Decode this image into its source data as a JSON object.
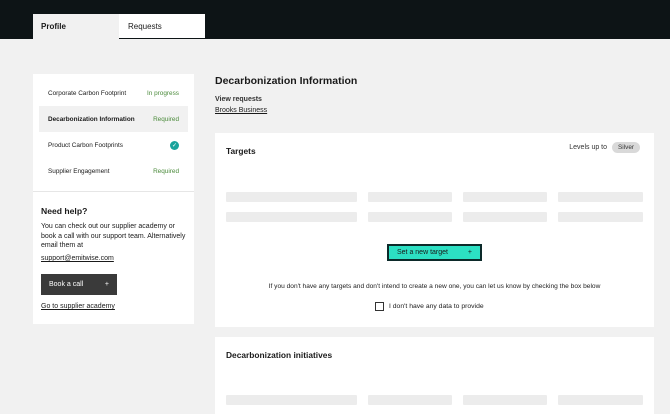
{
  "tabs": [
    {
      "label": "Profile",
      "active": true
    },
    {
      "label": "Requests",
      "active": false
    }
  ],
  "sidebar": {
    "items": [
      {
        "label": "Corporate Carbon Footprint",
        "status": "In progress"
      },
      {
        "label": "Decarbonization Information",
        "status": "Required"
      },
      {
        "label": "Product Carbon Footprints",
        "status": "check-circle-icon"
      },
      {
        "label": "Supplier Engagement",
        "status": "Required"
      }
    ],
    "help": {
      "title": "Need help?",
      "text": "You can check out our supplier academy or book a call with our support team. Alternatively email them at",
      "email": "support@emitwise.com",
      "book_call": "Book a call",
      "academy_link": "Go to supplier academy"
    }
  },
  "main": {
    "title": "Decarbonization Information",
    "view_requests_label": "View requests",
    "view_requests_link": "Brooks Business",
    "targets": {
      "title": "Targets",
      "levels_label": "Levels up to",
      "level_badge": "Silver",
      "cta": "Set a new target",
      "note": "If you don't have any targets and don't intend to create a new one, you can let us know by checking the box below",
      "checkbox_label": "I don't have any data to provide",
      "checkbox_checked": false
    },
    "initiatives": {
      "title": "Decarbonization initiatives"
    }
  },
  "colors": {
    "topbar": "#0d1416",
    "accent": "#2ce0c3",
    "check": "#1ba39c",
    "status_text": "#4a8a3a"
  }
}
